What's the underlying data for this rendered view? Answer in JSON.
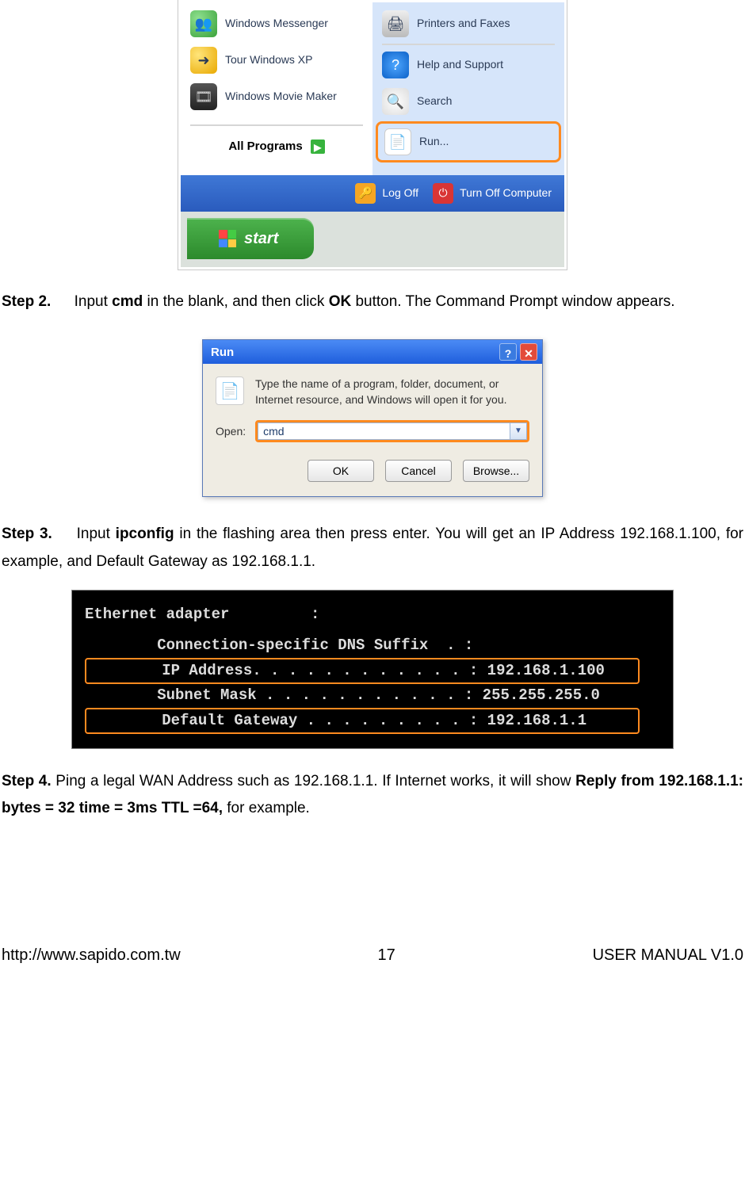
{
  "start_menu": {
    "left_items": [
      {
        "label": "Windows Messenger"
      },
      {
        "label": "Tour Windows XP"
      },
      {
        "label": "Windows Movie Maker"
      }
    ],
    "all_programs": "All Programs",
    "right_items": [
      {
        "label": "Printers and Faxes"
      },
      {
        "label": "Help and Support"
      },
      {
        "label": "Search"
      },
      {
        "label": "Run..."
      }
    ],
    "footer": {
      "logoff": "Log Off",
      "turnoff": "Turn Off Computer"
    },
    "start_label": "start"
  },
  "step2": {
    "no": "Step 2.",
    "t1": "Input ",
    "cmd": "cmd",
    "t2": " in the blank, and then click ",
    "ok": "OK",
    "t3": " button. The Command Prompt window appears."
  },
  "run_dialog": {
    "title": "Run",
    "desc": "Type the name of a program, folder, document, or Internet resource, and Windows will open it for you.",
    "open_label": "Open:",
    "value": "cmd",
    "buttons": {
      "ok": "OK",
      "cancel": "Cancel",
      "browse": "Browse..."
    }
  },
  "step3": {
    "no": "Step 3.",
    "t1": "Input ",
    "ipconfig": "ipconfig",
    "t2": " in the flashing area then press enter. You will get an IP Address 192.168.1.100, for example, and Default Gateway as 192.168.1.1."
  },
  "cmd": {
    "l1": "Ethernet adapter         :",
    "l2": "        Connection-specific DNS Suffix  . :",
    "l3": "        IP Address. . . . . . . . . . . . : 192.168.1.100",
    "l4": "        Subnet Mask . . . . . . . . . . . : 255.255.255.0",
    "l5": "        Default Gateway . . . . . . . . . : 192.168.1.1"
  },
  "step4": {
    "no": "Step 4.",
    "t1": " Ping a legal WAN Address such as 192.168.1.1. If Internet works, it will show ",
    "reply": "Reply from 192.168.1.1: bytes = 32 time = 3ms TTL =64,",
    "t2": " for example."
  },
  "footer": {
    "url": "http://www.sapido.com.tw",
    "page": "17",
    "version": "USER MANUAL V1.0"
  }
}
